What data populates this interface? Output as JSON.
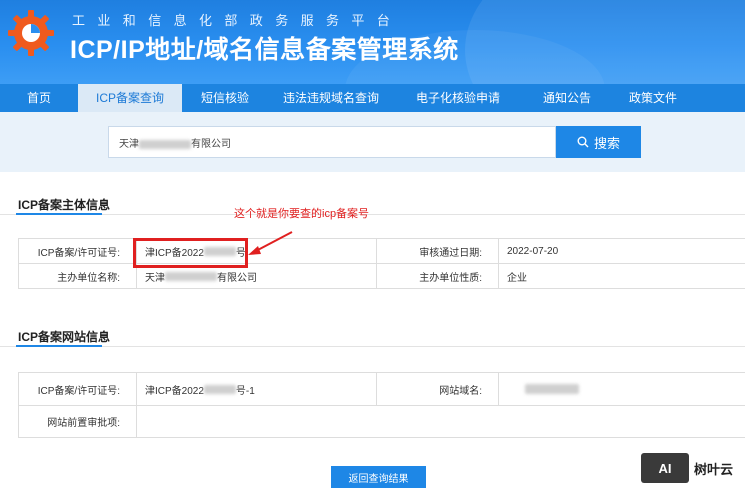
{
  "header": {
    "subtitle": "工业和信息化部政务服务平台",
    "title": "ICP/IP地址/域名信息备案管理系统"
  },
  "nav": [
    {
      "label": "首页",
      "active": false
    },
    {
      "label": "ICP备案查询",
      "active": true
    },
    {
      "label": "短信核验",
      "active": false
    },
    {
      "label": "违法违规域名查询",
      "active": false
    },
    {
      "label": "电子化核验申请",
      "active": false
    },
    {
      "label": "通知公告",
      "active": false
    },
    {
      "label": "政策文件",
      "active": false
    }
  ],
  "search": {
    "prefix": "天津",
    "suffix": "有限公司",
    "button_label": "搜索"
  },
  "subject_section": {
    "title": "ICP备案主体信息",
    "license_label": "ICP备案/许可证号:",
    "license_prefix": "津ICP备2022",
    "license_suffix": "号",
    "approve_label": "审核通过日期:",
    "approve_date": "2022-07-20",
    "org_label": "主办单位名称:",
    "org_prefix": "天津",
    "org_suffix": "有限公司",
    "nature_label": "主办单位性质:",
    "nature_value": "企业"
  },
  "annotation": {
    "text": "这个就是你要查的icp备案号"
  },
  "site_section": {
    "title": "ICP备案网站信息",
    "license_label": "ICP备案/许可证号:",
    "license_prefix": "津ICP备2022",
    "license_suffix": "号-1",
    "domain_label": "网站域名:",
    "pre_approval_label": "网站前置审批项:"
  },
  "back_button": "返回查询结果",
  "watermark": {
    "badge": "AI",
    "text": "树叶云"
  },
  "colors": {
    "primary": "#1e87e6",
    "nav_active_bg": "#dbe9f6",
    "annotation": "#e02020"
  }
}
